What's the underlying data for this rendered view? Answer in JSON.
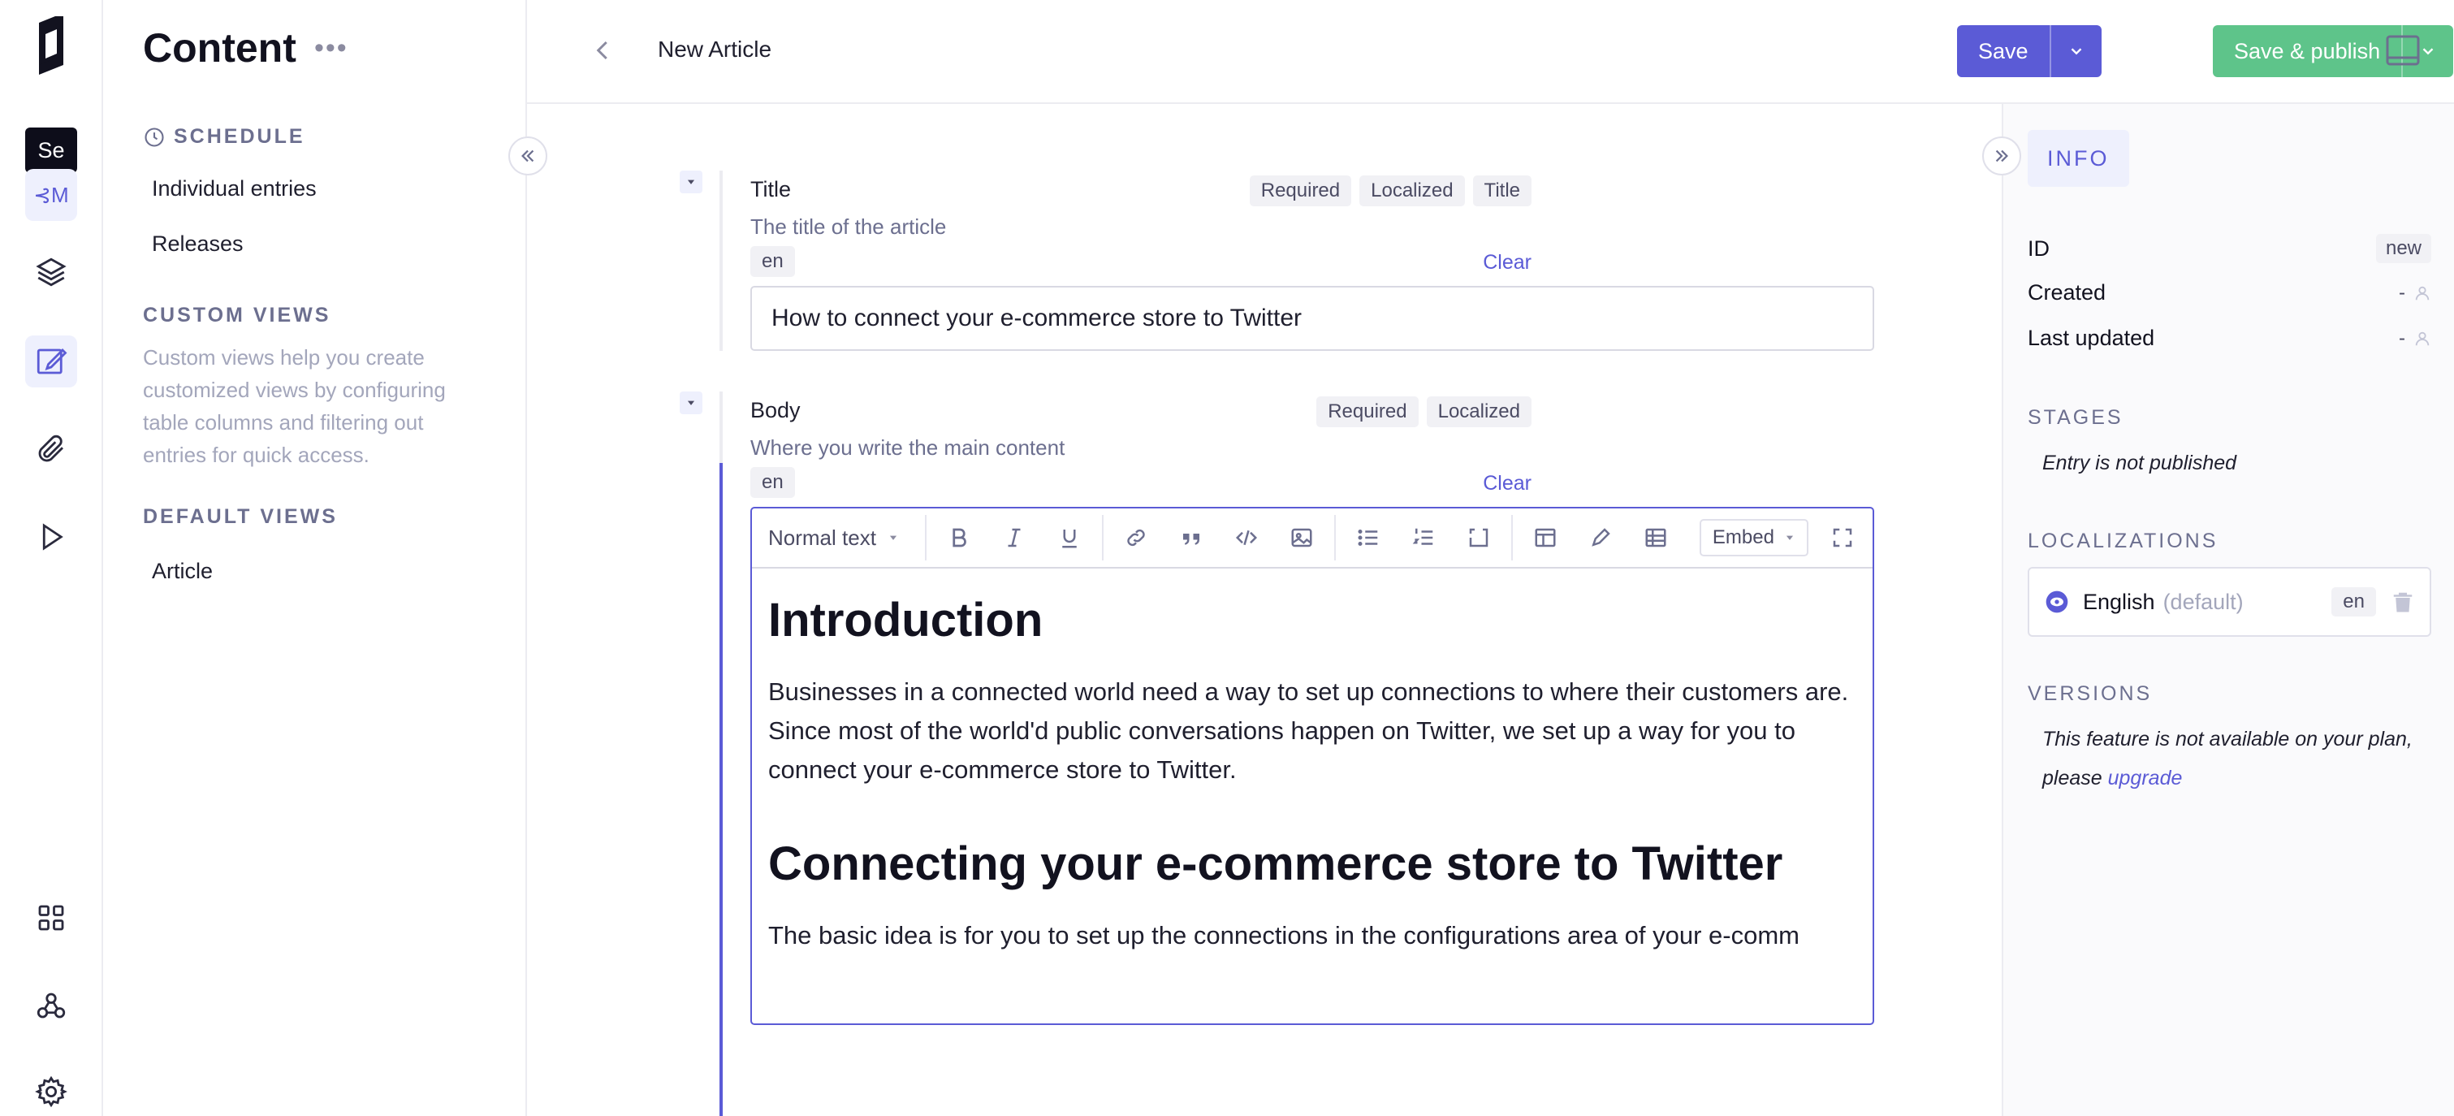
{
  "rail": {
    "tooltip": "Se",
    "tooltip_target": "⊰M"
  },
  "sidebar": {
    "title": "Content",
    "more": "•••",
    "schedule_label": "SCHEDULE",
    "schedule_items": [
      "Individual entries",
      "Releases"
    ],
    "custom_views_label": "CUSTOM VIEWS",
    "custom_views_desc": "Custom views help you create customized views by configuring table columns and filtering out entries for quick access.",
    "default_views_label": "DEFAULT VIEWS",
    "default_views_items": [
      "Article"
    ]
  },
  "header": {
    "title": "New Article",
    "save_label": "Save",
    "publish_label": "Save & publish"
  },
  "fields": {
    "title": {
      "label": "Title",
      "help": "The title of the article",
      "locale": "en",
      "clear": "Clear",
      "tags": [
        "Required",
        "Localized",
        "Title"
      ],
      "value": "How to connect your e-commerce store to Twitter"
    },
    "body": {
      "label": "Body",
      "help": "Where you write the main content",
      "locale": "en",
      "clear": "Clear",
      "tags": [
        "Required",
        "Localized"
      ],
      "toolbar": {
        "block_type": "Normal text",
        "embed": "Embed"
      },
      "content": {
        "h1": "Introduction",
        "p1": "Businesses in a connected world need a way to set up connections to where their customers are. Since most of the world'd public conversations happen on Twitter, we set up a way for you to connect your e-commerce store to Twitter.",
        "h2": "Connecting your e-commerce store to Twitter",
        "p2": "The basic idea is for you to set up the connections in the configurations area of your e-comm"
      }
    }
  },
  "info_panel": {
    "tab": "INFO",
    "id_label": "ID",
    "id_value": "new",
    "created_label": "Created",
    "created_value": "-",
    "updated_label": "Last updated",
    "updated_value": "-",
    "stages_label": "STAGES",
    "stages_text": "Entry is not published",
    "localizations_label": "LOCALIZATIONS",
    "locale_name": "English",
    "locale_default": "(default)",
    "locale_code": "en",
    "versions_label": "VERSIONS",
    "versions_text": "This feature is not available on your plan, please",
    "versions_link": "upgrade"
  },
  "colors": {
    "accent": "#5b5bd6",
    "publish": "#5ec48a"
  }
}
